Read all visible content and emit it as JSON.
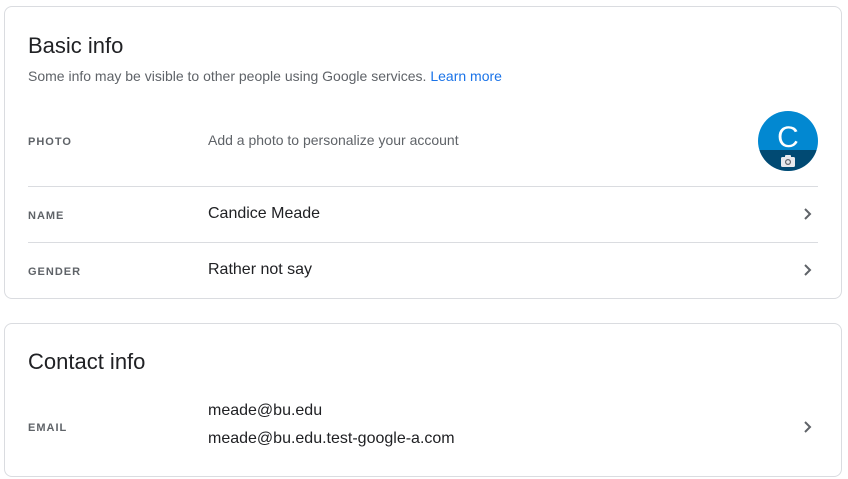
{
  "basic_info": {
    "title": "Basic info",
    "subtitle": "Some info may be visible to other people using Google services.",
    "learn_more": "Learn more",
    "photo": {
      "label": "PHOTO",
      "value": "Add a photo to personalize your account",
      "avatar_letter": "C"
    },
    "name": {
      "label": "NAME",
      "value": "Candice Meade"
    },
    "gender": {
      "label": "GENDER",
      "value": "Rather not say"
    }
  },
  "contact_info": {
    "title": "Contact info",
    "email": {
      "label": "EMAIL",
      "values": [
        "meade@bu.edu",
        "meade@bu.edu.test-google-a.com"
      ]
    }
  },
  "colors": {
    "accent": "#1a73e8",
    "avatar": "#0288d1",
    "divider": "#dadce0",
    "muted": "#5f6368"
  },
  "icons": [
    "chevron-right-icon",
    "camera-icon"
  ]
}
